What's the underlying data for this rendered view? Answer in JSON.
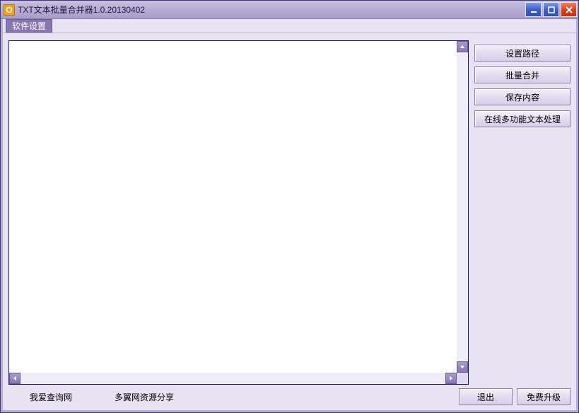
{
  "titlebar": {
    "title": "TXT文本批量合并器1.0.20130402"
  },
  "menubar": {
    "settings": "软件设置"
  },
  "side": {
    "set_path": "设置路径",
    "batch_merge": "批量合并",
    "save_content": "保存内容",
    "online_tool": "在线多功能文本处理"
  },
  "footer": {
    "link1": "我爱查询网",
    "link2": "多翼网资源分享",
    "exit": "退出",
    "upgrade": "免费升级"
  },
  "textarea_value": ""
}
